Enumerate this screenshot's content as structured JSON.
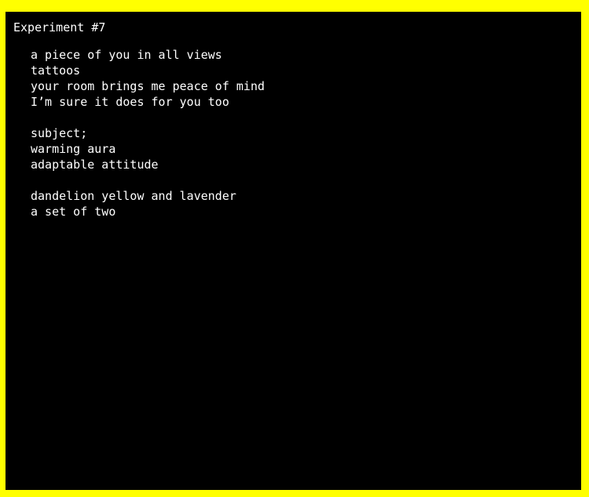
{
  "colors": {
    "border": "#ffff00",
    "background": "#000000",
    "text": "#ffffff"
  },
  "title": "Experiment #7",
  "stanzas": [
    {
      "lines": [
        "a piece of you in all views",
        "tattoos",
        "your room brings me peace of mind",
        "I’m sure it does for you too"
      ]
    },
    {
      "lines": [
        "subject;",
        "warming aura",
        "adaptable attitude"
      ]
    },
    {
      "lines": [
        "dandelion yellow and lavender",
        "a set of two"
      ]
    }
  ]
}
